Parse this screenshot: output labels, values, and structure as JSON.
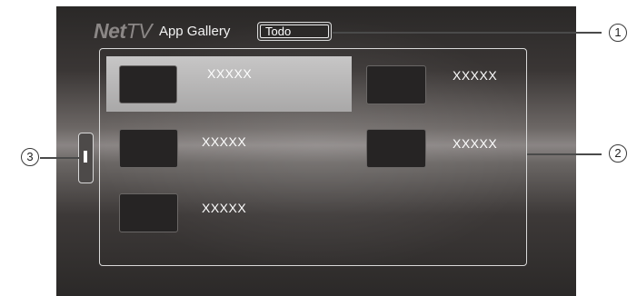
{
  "header": {
    "logo_net": "Net",
    "logo_tv": "TV",
    "title": "App Gallery",
    "category_value": "Todo"
  },
  "apps": [
    {
      "label": "XXXXX",
      "selected": true
    },
    {
      "label": "XXXXX",
      "selected": false
    },
    {
      "label": "XXXXX",
      "selected": false
    },
    {
      "label": "XXXXX",
      "selected": false
    },
    {
      "label": "XXXXX",
      "selected": false
    }
  ],
  "callouts": {
    "category": "1",
    "grid": "2",
    "scrollbar": "3"
  },
  "colors": {
    "selected_tile": "#b9b8b8",
    "frame_border": "#d9d9d9",
    "label_text": "#ffffff"
  }
}
